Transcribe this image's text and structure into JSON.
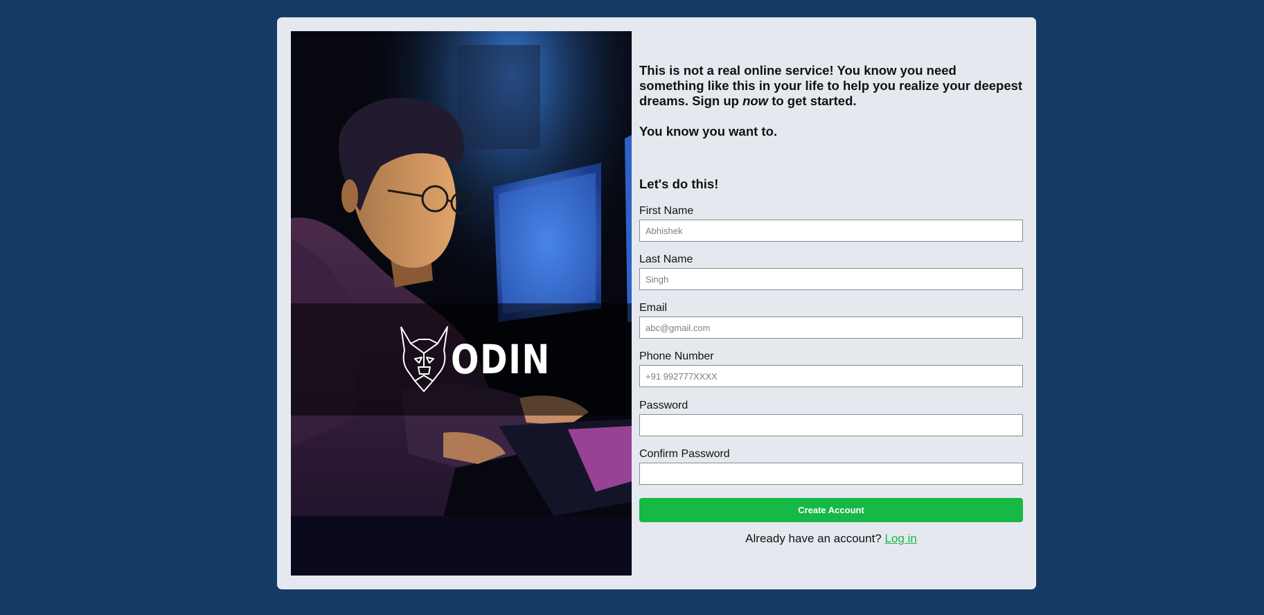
{
  "colors": {
    "page_background": "#153a66",
    "card_background": "#e5e9ef",
    "accent": "#16b846"
  },
  "hero": {
    "icons": [
      "odin-viking-helmet-logo"
    ],
    "logo_text": "ODIN"
  },
  "intro": {
    "paragraph_before": "This is not a real online service! You know you need something like this in your life to help you realize your deepest dreams. Sign up ",
    "paragraph_emphasis": "now",
    "paragraph_after": " to get started.",
    "tagline": "You know you want to."
  },
  "form": {
    "title": "Let's do this!",
    "fields": [
      {
        "label": "First Name",
        "placeholder": "Abhishek",
        "value": ""
      },
      {
        "label": "Last Name",
        "placeholder": "Singh",
        "value": ""
      },
      {
        "label": "Email",
        "placeholder": "abc@gmail.com",
        "value": ""
      },
      {
        "label": "Phone Number",
        "placeholder": "+91 992777XXXX",
        "value": ""
      },
      {
        "label": "Password",
        "placeholder": "",
        "value": ""
      },
      {
        "label": "Confirm Password",
        "placeholder": "",
        "value": ""
      }
    ],
    "submit_label": "Create Account",
    "login_prompt": "Already have an account?",
    "login_link": "Log in"
  }
}
